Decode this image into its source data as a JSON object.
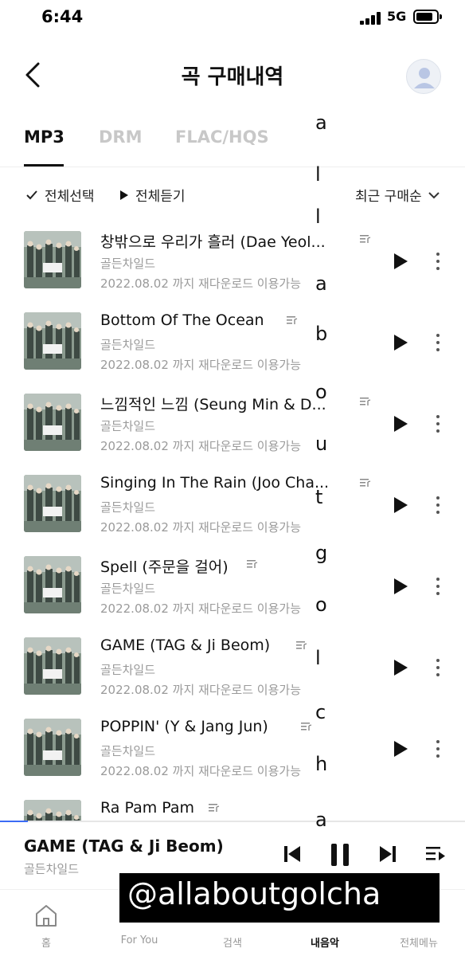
{
  "status_bar": {
    "time": "6:44",
    "network": "5G"
  },
  "header": {
    "title": "곡 구매내역"
  },
  "tabs": [
    {
      "label": "MP3",
      "active": true
    },
    {
      "label": "DRM",
      "active": false
    },
    {
      "label": "FLAC/HQS",
      "active": false
    }
  ],
  "toolbar": {
    "select_all": "전체선택",
    "play_all": "전체듣기",
    "sort": "최근 구매순"
  },
  "songs": [
    {
      "title": "창밖으로 우리가 흘러 (Dae Yeol...",
      "artist": "골든차일드",
      "expiry": "2022.08.02 까지 재다운로드 이용가능"
    },
    {
      "title": "Bottom Of The Ocean",
      "artist": "골든차일드",
      "expiry": "2022.08.02 까지 재다운로드 이용가능"
    },
    {
      "title": "느낌적인 느낌 (Seung Min & D...",
      "artist": "골든차일드",
      "expiry": "2022.08.02 까지 재다운로드 이용가능"
    },
    {
      "title": "Singing In The Rain (Joo Cha...",
      "artist": "골든차일드",
      "expiry": "2022.08.02 까지 재다운로드 이용가능"
    },
    {
      "title": "Spell (주문을 걸어)",
      "artist": "골든차일드",
      "expiry": "2022.08.02 까지 재다운로드 이용가능"
    },
    {
      "title": "GAME (TAG & Ji Beom)",
      "artist": "골든차일드",
      "expiry": "2022.08.02 까지 재다운로드 이용가능"
    },
    {
      "title": "POPPIN' (Y & Jang Jun)",
      "artist": "골든차일드",
      "expiry": "2022.08.02 까지 재다운로드 이용가능"
    },
    {
      "title": "Ra Pam Pam",
      "artist": "",
      "expiry": ""
    }
  ],
  "overlay_letters": [
    "a",
    "l",
    "l",
    "a",
    "b",
    "o",
    "u",
    "t",
    "g",
    "o",
    "l",
    "c",
    "h",
    "a"
  ],
  "now_playing": {
    "title": "GAME (TAG & Ji Beom)",
    "artist": "골든차일드",
    "progress": 0.06
  },
  "watermark": "@allaboutgolcha",
  "bottom_nav": [
    {
      "label": "홈",
      "active": false
    },
    {
      "label": "For You",
      "active": false
    },
    {
      "label": "검색",
      "active": false
    },
    {
      "label": "내음악",
      "active": true
    },
    {
      "label": "전체메뉴",
      "active": false
    }
  ],
  "colors": {
    "accent": "#3b6cf5",
    "text": "#111111",
    "muted": "#999999",
    "tab_inactive": "#c8c8c8"
  },
  "icons": {
    "back": "chevron-left-icon",
    "avatar": "user-avatar-icon",
    "check": "check-icon",
    "play": "play-icon",
    "sort": "chevron-down-icon",
    "lyrics": "lyrics-icon",
    "more": "more-vertical-icon",
    "prev": "skip-previous-icon",
    "pause": "pause-icon",
    "next": "skip-next-icon",
    "playlist": "playlist-icon",
    "home": "home-icon"
  }
}
